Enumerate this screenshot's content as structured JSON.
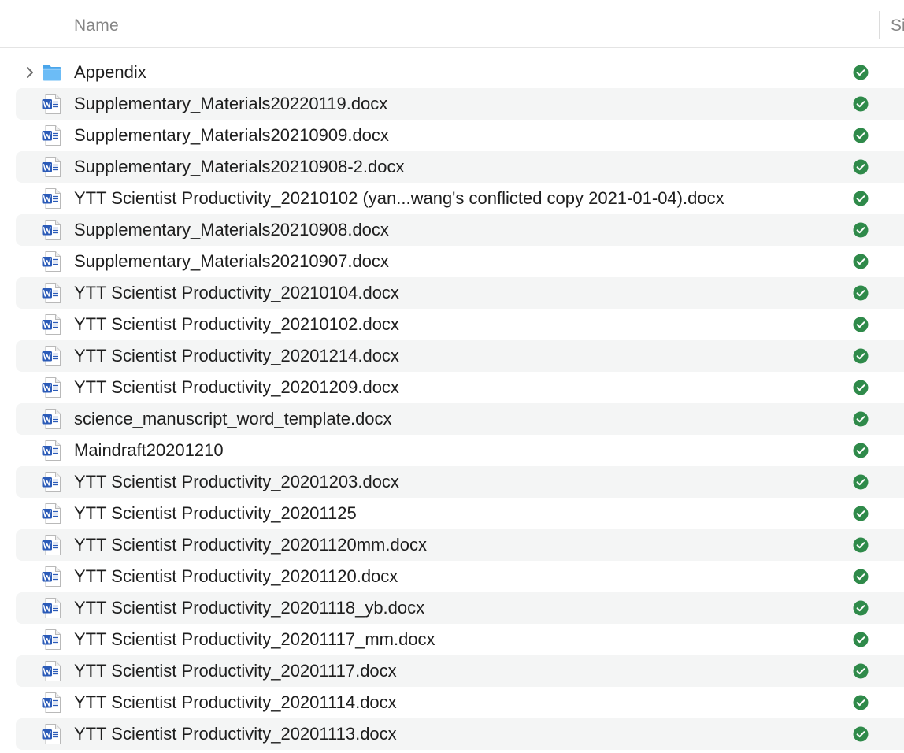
{
  "header": {
    "name_label": "Name",
    "size_label": "Si"
  },
  "colors": {
    "sync_ok": "#2f8a4a",
    "folder": "#5cb2f2",
    "word_blue": "#2b5bb8",
    "row_alt": "#f4f5f5"
  },
  "items": [
    {
      "label": "Appendix",
      "type": "folder",
      "status": "synced"
    },
    {
      "label": "Supplementary_Materials20220119.docx",
      "type": "word",
      "status": "synced"
    },
    {
      "label": "Supplementary_Materials20210909.docx",
      "type": "word",
      "status": "synced"
    },
    {
      "label": "Supplementary_Materials20210908-2.docx",
      "type": "word",
      "status": "synced"
    },
    {
      "label": "YTT Scientist Productivity_20210102 (yan...wang's conflicted copy 2021-01-04).docx",
      "type": "word",
      "status": "synced"
    },
    {
      "label": "Supplementary_Materials20210908.docx",
      "type": "word",
      "status": "synced"
    },
    {
      "label": "Supplementary_Materials20210907.docx",
      "type": "word",
      "status": "synced"
    },
    {
      "label": "YTT Scientist Productivity_20210104.docx",
      "type": "word",
      "status": "synced"
    },
    {
      "label": "YTT Scientist Productivity_20210102.docx",
      "type": "word",
      "status": "synced"
    },
    {
      "label": "YTT Scientist Productivity_20201214.docx",
      "type": "word",
      "status": "synced"
    },
    {
      "label": "YTT Scientist Productivity_20201209.docx",
      "type": "word",
      "status": "synced"
    },
    {
      "label": "science_manuscript_word_template.docx",
      "type": "word",
      "status": "synced"
    },
    {
      "label": "Maindraft20201210",
      "type": "word",
      "status": "synced"
    },
    {
      "label": "YTT Scientist Productivity_20201203.docx",
      "type": "word",
      "status": "synced"
    },
    {
      "label": "YTT Scientist Productivity_20201125",
      "type": "word",
      "status": "synced"
    },
    {
      "label": "YTT Scientist Productivity_20201120mm.docx",
      "type": "word",
      "status": "synced"
    },
    {
      "label": "YTT Scientist Productivity_20201120.docx",
      "type": "word",
      "status": "synced"
    },
    {
      "label": "YTT Scientist Productivity_20201118_yb.docx",
      "type": "word",
      "status": "synced"
    },
    {
      "label": "YTT Scientist Productivity_20201117_mm.docx",
      "type": "word",
      "status": "synced"
    },
    {
      "label": "YTT Scientist Productivity_20201117.docx",
      "type": "word",
      "status": "synced"
    },
    {
      "label": "YTT Scientist Productivity_20201114.docx",
      "type": "word",
      "status": "synced"
    },
    {
      "label": "YTT Scientist Productivity_20201113.docx",
      "type": "word",
      "status": "synced"
    }
  ]
}
